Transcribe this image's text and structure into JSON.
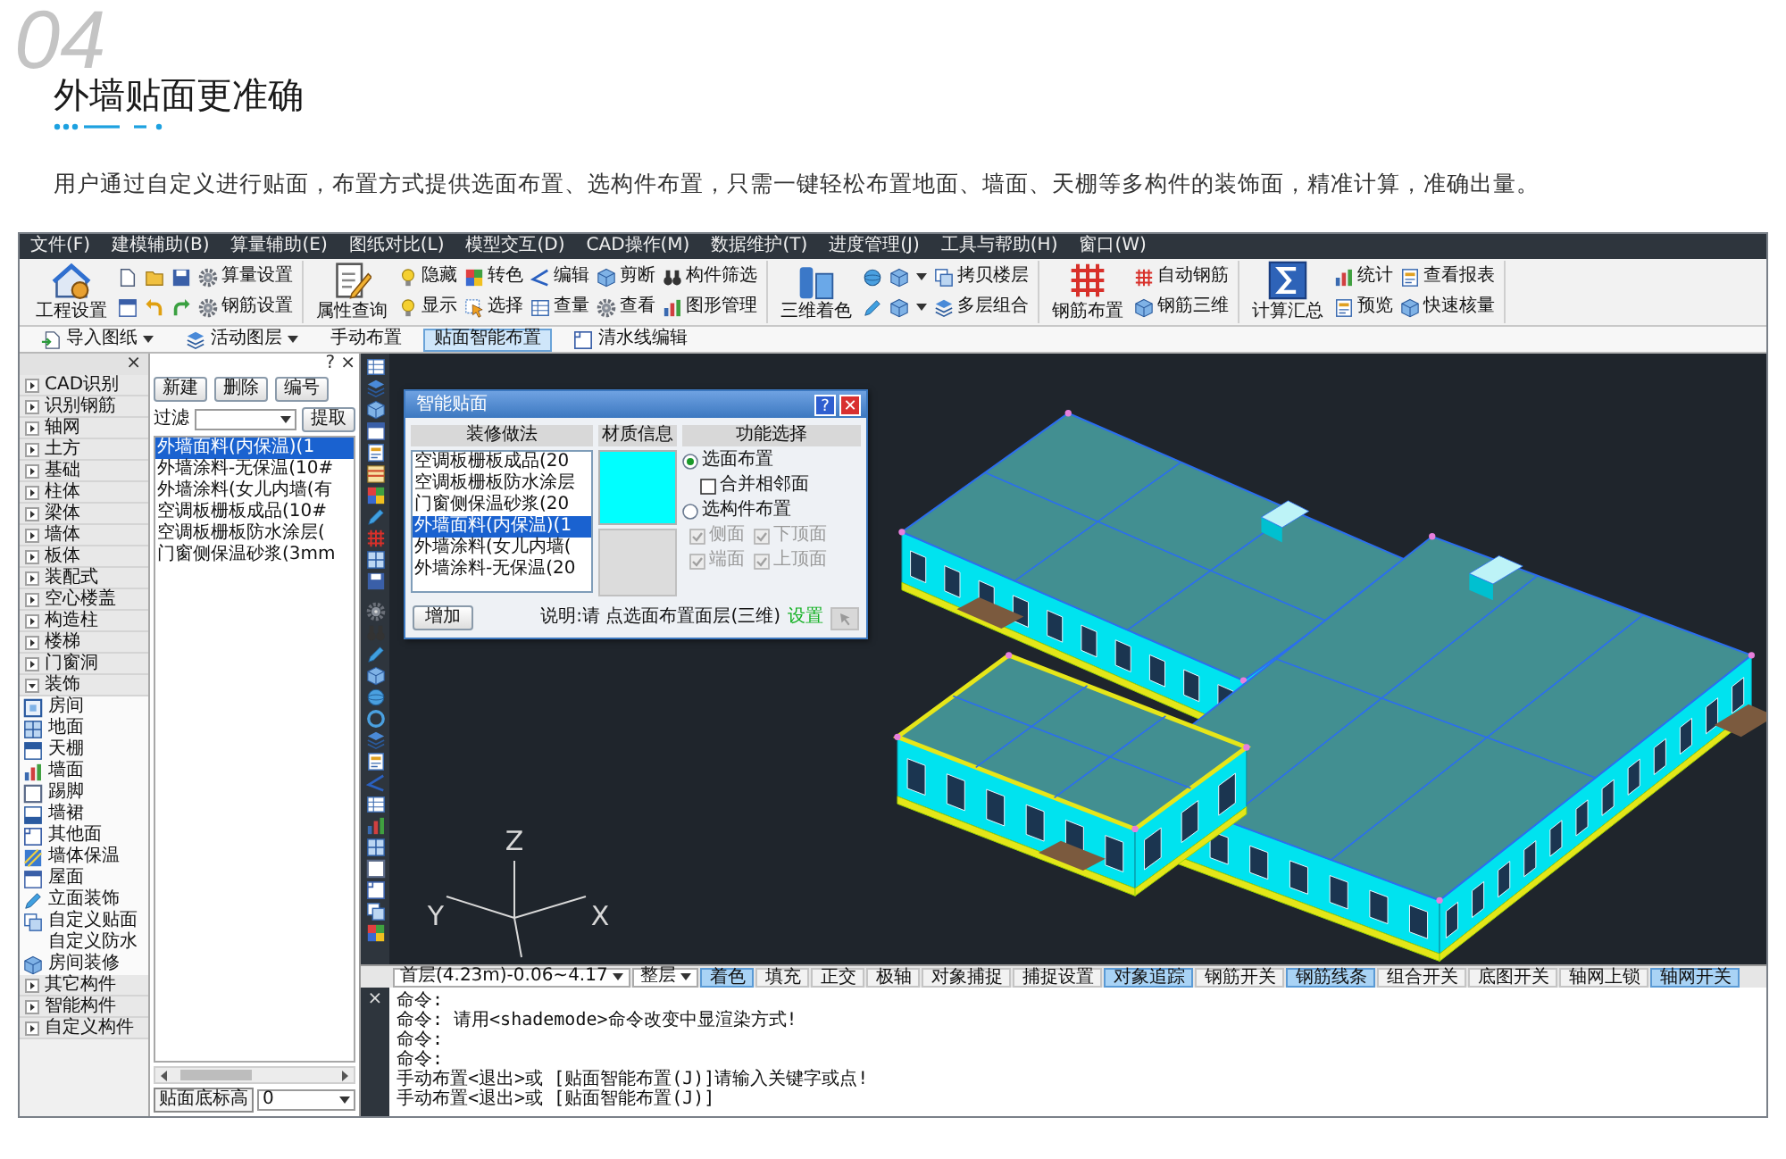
{
  "header": {
    "number": "04",
    "title": "外墙贴面更准确",
    "description": "用户通过自定义进行贴面，布置方式提供选面布置、选构件布置，只需一键轻松布置地面、墙面、天棚等多构件的装饰面，精准计算，准确出量。"
  },
  "app": {
    "menu": [
      "文件(F)",
      "建模辅助(B)",
      "算量辅助(E)",
      "图纸对比(L)",
      "模型交互(D)",
      "CAD操作(M)",
      "数据维护(T)",
      "进度管理(J)",
      "工具与帮助(H)",
      "窗口(W)"
    ],
    "ribbon": [
      {
        "label": "工程设置",
        "rows": [
          [
            {
              "kind": "icon"
            },
            {
              "kind": "icon"
            },
            {
              "kind": "icon"
            },
            {
              "kind": "tool",
              "label": "算量设置"
            }
          ],
          [
            {
              "kind": "icon"
            },
            {
              "kind": "icon"
            },
            {
              "kind": "icon"
            },
            {
              "kind": "tool",
              "label": "钢筋设置"
            }
          ]
        ]
      },
      {
        "label": "属性查询",
        "rows": [
          [
            {
              "kind": "tool",
              "label": "隐藏"
            },
            {
              "kind": "tool",
              "label": "转色"
            },
            {
              "kind": "tool",
              "label": "编辑"
            },
            {
              "kind": "tool",
              "label": "剪断"
            },
            {
              "kind": "tool",
              "label": "构件筛选"
            }
          ],
          [
            {
              "kind": "tool",
              "label": "显示"
            },
            {
              "kind": "tool",
              "label": "选择"
            },
            {
              "kind": "tool",
              "label": "查量"
            },
            {
              "kind": "tool",
              "label": "查看"
            },
            {
              "kind": "tool",
              "label": "图形管理"
            }
          ]
        ]
      },
      {
        "label": "三维着色",
        "rows": [
          [
            {
              "kind": "icon"
            },
            {
              "kind": "icon-menu"
            },
            {
              "kind": "tool",
              "label": "拷贝楼层"
            }
          ],
          [
            {
              "kind": "icon"
            },
            {
              "kind": "icon-menu"
            },
            {
              "kind": "tool",
              "label": "多层组合"
            }
          ]
        ]
      },
      {
        "label": "钢筋布置",
        "rows": [
          [
            {
              "kind": "tool",
              "label": "自动钢筋"
            }
          ],
          [
            {
              "kind": "tool",
              "label": "钢筋三维"
            }
          ]
        ]
      },
      {
        "label": "计算汇总",
        "rows": [
          [
            {
              "kind": "tool",
              "label": "统计"
            },
            {
              "kind": "tool",
              "label": "查看报表"
            }
          ],
          [
            {
              "kind": "tool",
              "label": "预览"
            },
            {
              "kind": "tool",
              "label": "快速核量"
            }
          ]
        ]
      }
    ],
    "subtoolbar": [
      {
        "kind": "menu",
        "label": "导入图纸",
        "selected": false
      },
      {
        "kind": "menu",
        "label": "活动图层",
        "selected": false
      },
      {
        "kind": "button",
        "label": "手动布置",
        "selected": false
      },
      {
        "kind": "button",
        "label": "贴面智能布置",
        "selected": true
      },
      {
        "kind": "icon-button",
        "label": "清水线编辑",
        "selected": false
      }
    ],
    "tree_close": "×",
    "tree": [
      {
        "label": "CAD识别",
        "expanded": false
      },
      {
        "label": "识别钢筋",
        "expanded": false
      },
      {
        "label": "轴网",
        "expanded": false
      },
      {
        "label": "土方",
        "expanded": false
      },
      {
        "label": "基础",
        "expanded": false
      },
      {
        "label": "柱体",
        "expanded": false
      },
      {
        "label": "梁体",
        "expanded": false
      },
      {
        "label": "墙体",
        "expanded": false
      },
      {
        "label": "板体",
        "expanded": false
      },
      {
        "label": "装配式",
        "expanded": false
      },
      {
        "label": "空心楼盖",
        "expanded": false
      },
      {
        "label": "构造柱",
        "expanded": false
      },
      {
        "label": "楼梯",
        "expanded": false
      },
      {
        "label": "门窗洞",
        "expanded": false
      },
      {
        "label": "装饰",
        "expanded": true,
        "children": [
          {
            "label": "房间"
          },
          {
            "label": "地面"
          },
          {
            "label": "天棚"
          },
          {
            "label": "墙面"
          },
          {
            "label": "踢脚"
          },
          {
            "label": "墙裙"
          },
          {
            "label": "其他面"
          },
          {
            "label": "墙体保温"
          },
          {
            "label": "屋面"
          },
          {
            "label": "立面装饰"
          },
          {
            "label": "自定义贴面"
          },
          {
            "label": "自定义防水"
          },
          {
            "label": "房间装修"
          }
        ]
      },
      {
        "label": "其它构件",
        "expanded": false
      },
      {
        "label": "智能构件",
        "expanded": false
      },
      {
        "label": "自定义构件",
        "expanded": false
      }
    ],
    "materials": {
      "help": "?",
      "close": "×",
      "buttons": [
        "新建",
        "删除",
        "编号"
      ],
      "filter_label": "过滤",
      "extract": "提取",
      "items": [
        {
          "label": "外墙面料(内保温)(1",
          "selected": true
        },
        {
          "label": "外墙涂料-无保温(10#",
          "selected": false
        },
        {
          "label": "外墙涂料(女儿内墙(有",
          "selected": false
        },
        {
          "label": "空调板栅板成品(10#",
          "selected": false
        },
        {
          "label": "空调板栅板防水涂层(",
          "selected": false
        },
        {
          "label": "门窗侧保温砂浆(3mm",
          "selected": false
        }
      ],
      "elevation_label": "贴面底标高",
      "elevation_value": "0"
    },
    "canvas": {
      "axes": [
        "Z",
        "Y",
        "X"
      ],
      "dialog": {
        "title": "智能贴面",
        "help": "?",
        "close": "✕",
        "columns": [
          "装修做法",
          "材质信息",
          "功能选择"
        ],
        "items": [
          {
            "label": "空调板栅板成品(20",
            "selected": false
          },
          {
            "label": "空调板栅板防水涂层",
            "selected": false
          },
          {
            "label": "门窗侧保温砂浆(20",
            "selected": false
          },
          {
            "label": "外墙面料(内保温)(1",
            "selected": true
          },
          {
            "label": "外墙涂料(女儿内墙(",
            "selected": false
          },
          {
            "label": "外墙涂料-无保温(20",
            "selected": false
          }
        ],
        "options": [
          {
            "kind": "radio",
            "label": "选面布置",
            "selected": true
          },
          {
            "kind": "checkbox",
            "label": "合并相邻面",
            "checked": false
          },
          {
            "kind": "radio",
            "label": "选构件布置",
            "selected": false
          }
        ],
        "faces": [
          {
            "label": "侧面",
            "checked": true,
            "disabled": true
          },
          {
            "label": "下顶面",
            "checked": true,
            "disabled": true
          },
          {
            "label": "端面",
            "checked": true,
            "disabled": true
          },
          {
            "label": "上顶面",
            "checked": true,
            "disabled": true
          }
        ],
        "add_button": "增加",
        "hint": "说明:请 点选面布置面层(三维)",
        "settings_link": "设置",
        "pick_button": {
          "disabled": true
        }
      }
    },
    "status": {
      "floor": "首层(4.23m)-0.06~4.17",
      "mode": "整层",
      "toggles": [
        {
          "label": "着色",
          "on": true
        },
        {
          "label": "填充",
          "on": false
        },
        {
          "label": "正交",
          "on": false
        },
        {
          "label": "极轴",
          "on": false
        },
        {
          "label": "对象捕捉",
          "on": false
        },
        {
          "label": "捕捉设置",
          "on": false
        },
        {
          "label": "对象追踪",
          "on": true
        },
        {
          "label": "钢筋开关",
          "on": false
        },
        {
          "label": "钢筋线条",
          "on": true
        },
        {
          "label": "组合开关",
          "on": false
        },
        {
          "label": "底图开关",
          "on": false
        },
        {
          "label": "轴网上锁",
          "on": false
        },
        {
          "label": "轴网开关",
          "on": true
        }
      ]
    },
    "command": {
      "close": "×",
      "lines": [
        "命令:",
        "命令: 请用<shademode>命令改变中显渲染方式!",
        "命令:",
        "命令:",
        "手动布置<退出>或 [贴面智能布置(J)]请输入关键字或点!",
        "手动布置<退出>或 [贴面智能布置(J)]"
      ]
    }
  }
}
